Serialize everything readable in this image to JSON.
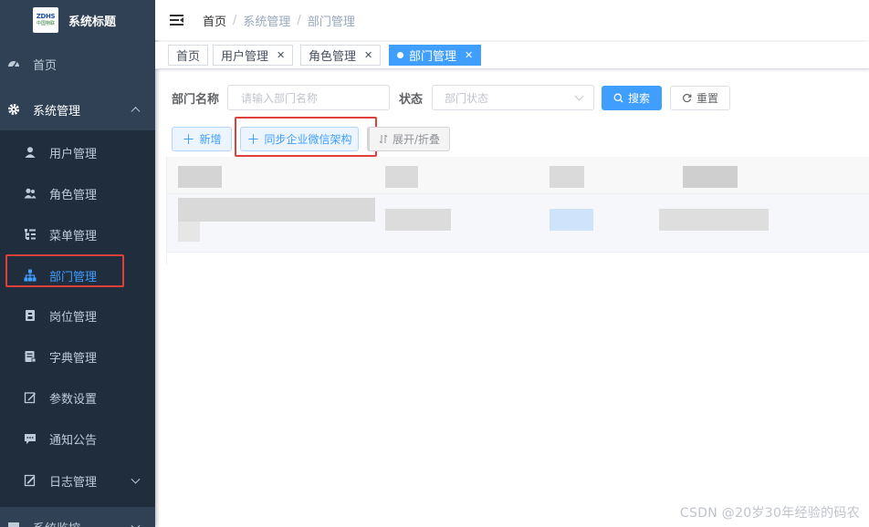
{
  "app": {
    "title": "系统标题",
    "logo_top": "ZDHS",
    "logo_bottom": "中国物联"
  },
  "sidebar": {
    "items": [
      {
        "label": "首页",
        "icon": "dashboard-icon"
      },
      {
        "label": "系统管理",
        "icon": "gear-icon"
      },
      {
        "label": "用户管理",
        "icon": "user-icon"
      },
      {
        "label": "角色管理",
        "icon": "peoples-icon"
      },
      {
        "label": "菜单管理",
        "icon": "tree-table-icon"
      },
      {
        "label": "部门管理",
        "icon": "tree-icon"
      },
      {
        "label": "岗位管理",
        "icon": "post-icon"
      },
      {
        "label": "字典管理",
        "icon": "dict-icon"
      },
      {
        "label": "参数设置",
        "icon": "edit-icon"
      },
      {
        "label": "通知公告",
        "icon": "message-icon"
      },
      {
        "label": "日志管理",
        "icon": "log-icon"
      },
      {
        "label": "系统监控",
        "icon": "monitor-icon"
      }
    ]
  },
  "breadcrumb": [
    "首页",
    "系统管理",
    "部门管理"
  ],
  "tags": [
    {
      "label": "首页"
    },
    {
      "label": "用户管理"
    },
    {
      "label": "角色管理"
    },
    {
      "label": "部门管理"
    }
  ],
  "search": {
    "dept_name_label": "部门名称",
    "dept_name_placeholder": "请输入部门名称",
    "status_label": "状态",
    "status_placeholder": "部门状态",
    "search_button": "搜索",
    "reset_button": "重置"
  },
  "toolbar": {
    "add_button": "新增",
    "sync_button": "同步企业微信架构",
    "expand_button": "展开/折叠"
  },
  "colors": {
    "sidebar_bg": "#304156",
    "submenu_bg": "#1f2d3d",
    "primary": "#409eff",
    "highlight": "#e0403a"
  },
  "watermark": "CSDN @20岁30年经验的码农"
}
